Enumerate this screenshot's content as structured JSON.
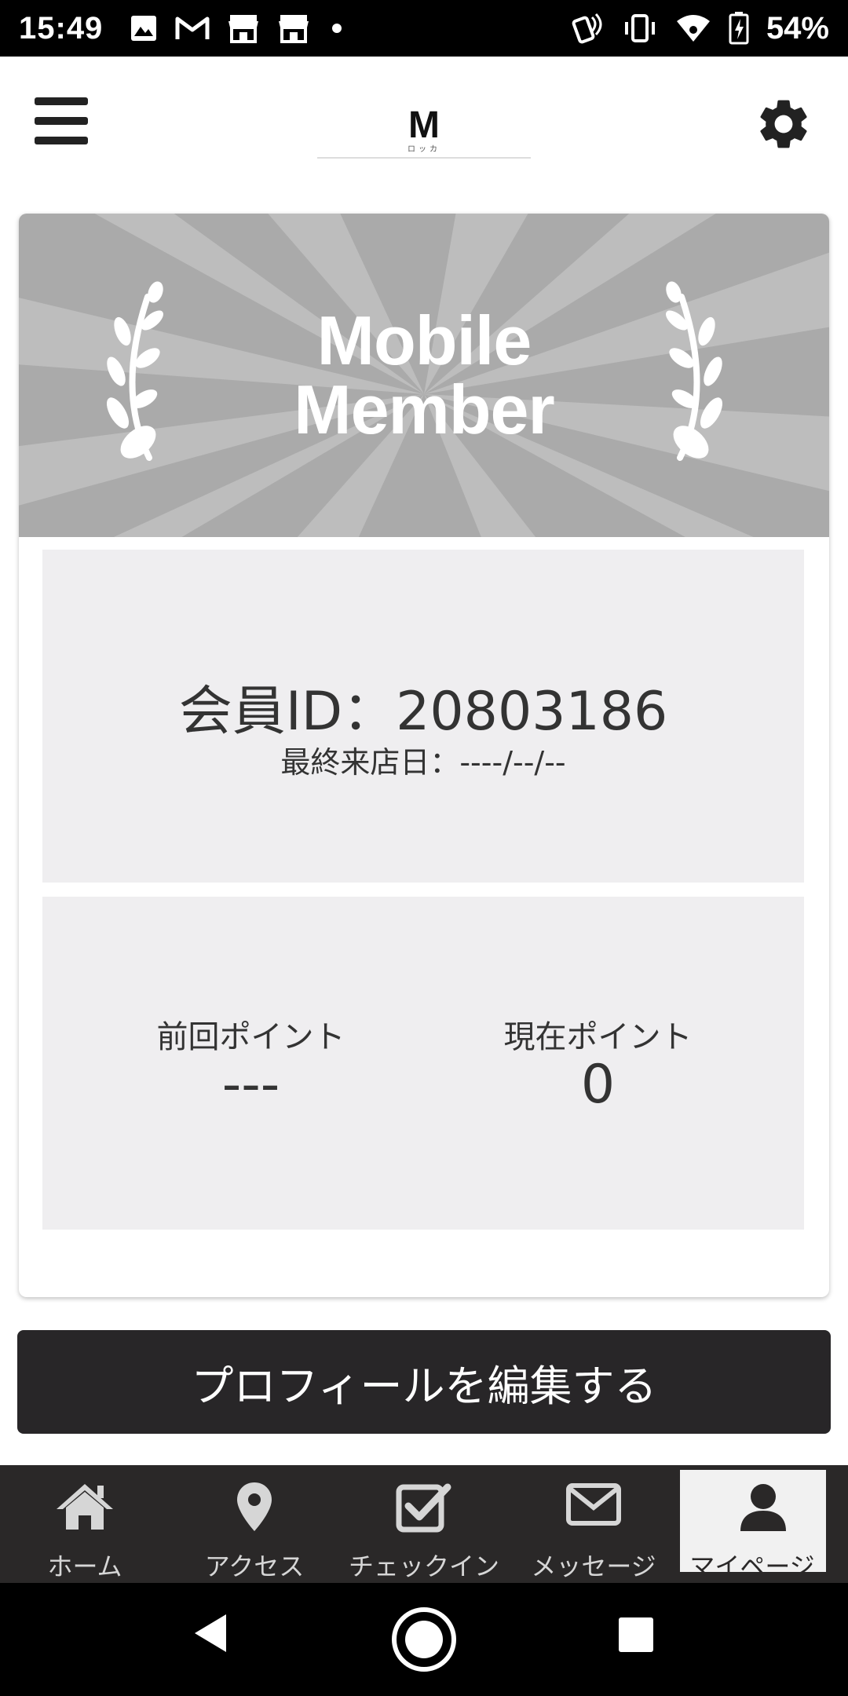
{
  "status_bar": {
    "time": "15:49",
    "battery": "54%",
    "notification_icons": [
      "image-icon",
      "gmail-icon",
      "store-icon",
      "store-icon",
      "dot-icon"
    ],
    "system_icons": [
      "nfc-icon",
      "vibrate-icon",
      "wifi-icon",
      "battery-icon"
    ]
  },
  "header": {
    "logo_text": "M",
    "logo_subtext": "ロッカ",
    "menu_icon": "hamburger-menu-icon",
    "settings_icon": "gear-icon"
  },
  "card": {
    "banner_title_line1": "Mobile",
    "banner_title_line2": "Member",
    "member_id": "会員ID：20803186",
    "last_visit": "最終来店日：----/--/--",
    "previous_points_label": "前回ポイント",
    "previous_points_value": "---",
    "current_points_label": "現在ポイント",
    "current_points_value": "0"
  },
  "edit_profile_button": "プロフィールを編集する",
  "bottom_nav": {
    "items": [
      {
        "label": "ホーム",
        "icon": "home-icon"
      },
      {
        "label": "アクセス",
        "icon": "map-pin-icon"
      },
      {
        "label": "チェックイン",
        "icon": "checkbox-icon"
      },
      {
        "label": "メッセージ",
        "icon": "envelope-icon"
      },
      {
        "label": "マイページ",
        "icon": "person-icon"
      }
    ],
    "active_index": 4
  },
  "colors": {
    "status_bar": "#000000",
    "banner": "#aaaaaa",
    "panel": "#efeef0",
    "button": "#282628",
    "nav_bg": "#2a2828",
    "nav_active_bg": "#f1f1f1"
  }
}
